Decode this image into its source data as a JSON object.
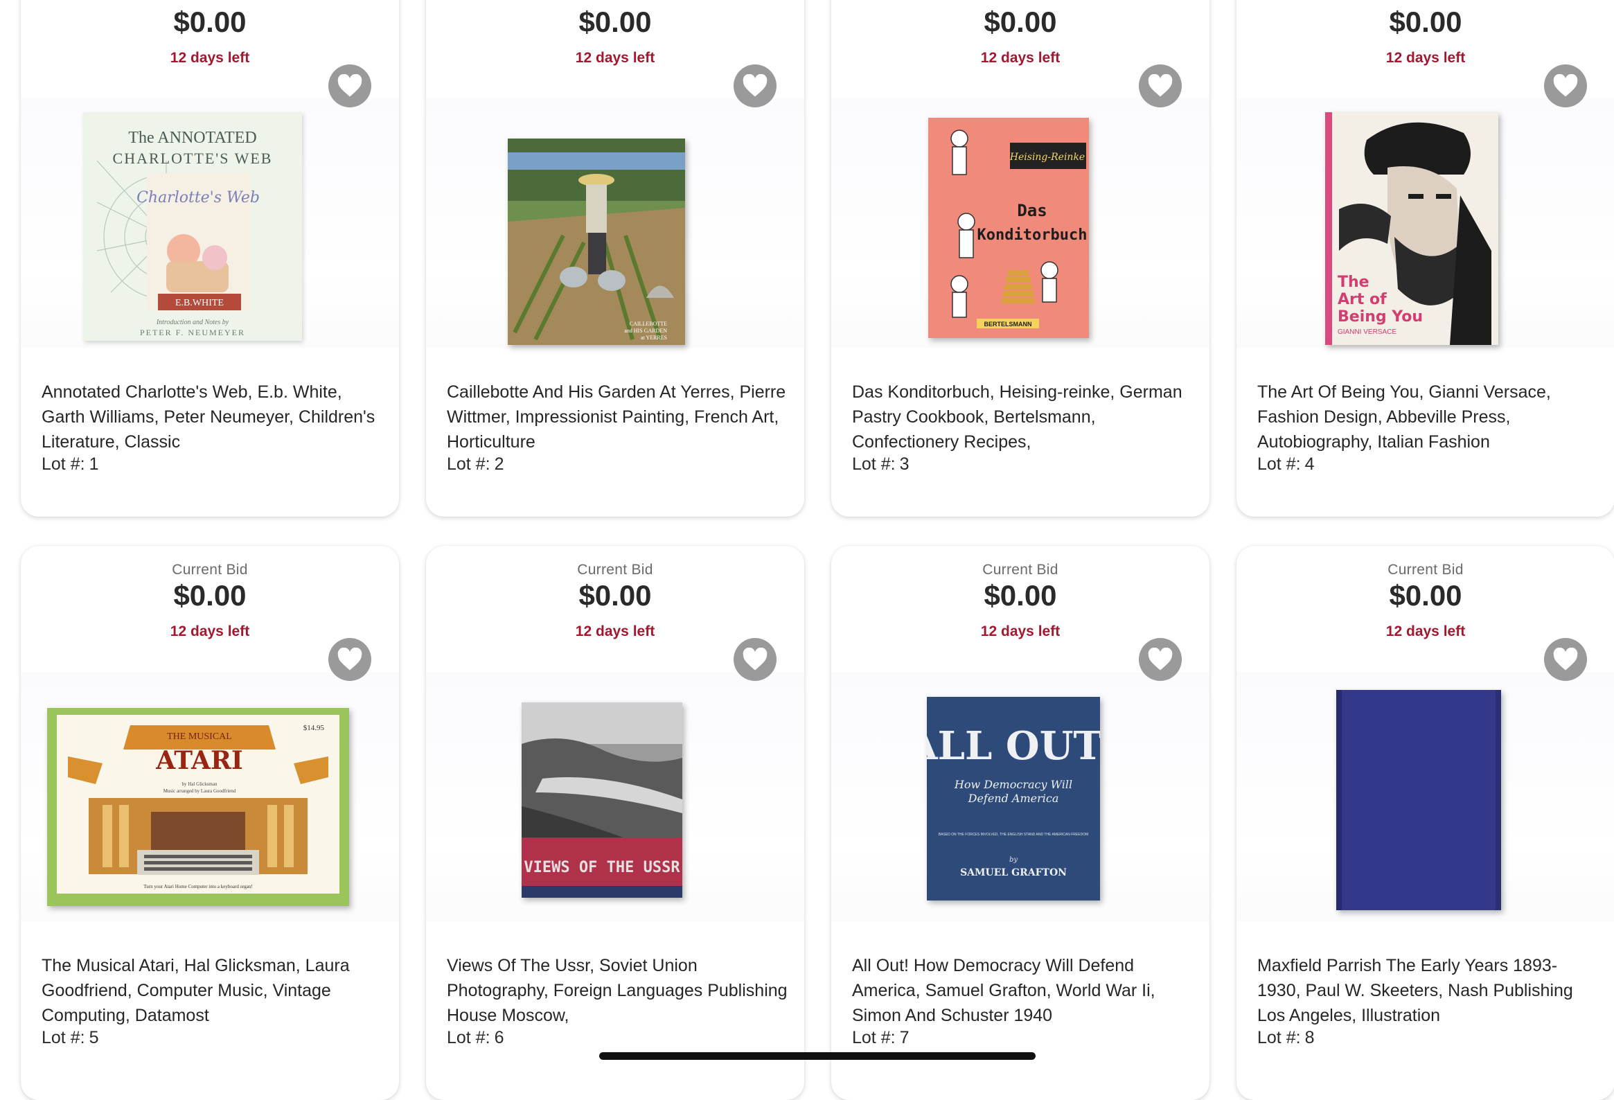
{
  "lots": [
    {
      "bid_label": "",
      "price": "$0.00",
      "time_left": "12 days left",
      "title": "Annotated Charlotte's Web, E.b. White, Garth Williams, Peter Neumeyer, Children's Literature, Classic",
      "lot_label": "Lot #:",
      "lot_number": "1"
    },
    {
      "bid_label": "",
      "price": "$0.00",
      "time_left": "12 days left",
      "title": "Caillebotte And His Garden At Yerres, Pierre Wittmer, Impressionist Painting, French Art, Horticulture",
      "lot_label": "Lot #:",
      "lot_number": "2"
    },
    {
      "bid_label": "",
      "price": "$0.00",
      "time_left": "12 days left",
      "title": "Das Konditorbuch, Heising-reinke, German Pastry Cookbook, Bertelsmann, Confectionery Recipes,",
      "lot_label": "Lot #:",
      "lot_number": "3"
    },
    {
      "bid_label": "",
      "price": "$0.00",
      "time_left": "12 days left",
      "title": "The Art Of Being You, Gianni Versace, Fashion Design, Abbeville Press, Autobiography, Italian Fashion",
      "lot_label": "Lot #:",
      "lot_number": "4"
    },
    {
      "bid_label": "Current Bid",
      "price": "$0.00",
      "time_left": "12 days left",
      "title": "The Musical Atari, Hal Glicksman, Laura Goodfriend, Computer Music, Vintage Computing, Datamost",
      "lot_label": "Lot #:",
      "lot_number": "5"
    },
    {
      "bid_label": "Current Bid",
      "price": "$0.00",
      "time_left": "12 days left",
      "title": "Views Of The Ussr, Soviet Union Photography, Foreign Languages Publishing House Moscow,",
      "lot_label": "Lot #:",
      "lot_number": "6"
    },
    {
      "bid_label": "Current Bid",
      "price": "$0.00",
      "time_left": "12 days left",
      "title": "All Out! How Democracy Will Defend America, Samuel Grafton, World War Ii, Simon And Schuster 1940",
      "lot_label": "Lot #:",
      "lot_number": "7"
    },
    {
      "bid_label": "Current Bid",
      "price": "$0.00",
      "time_left": "12 days left",
      "title": "Maxfield Parrish The Early Years 1893-1930, Paul W. Skeeters, Nash Publishing Los Angeles, Illustration",
      "lot_label": "Lot #:",
      "lot_number": "8"
    }
  ],
  "covers": {
    "charlotte": {
      "line1": "The ANNOTATED",
      "line2": "CHARLOTTE'S WEB",
      "script": "Charlotte's Web",
      "author": "E.B.WHITE",
      "credit1": "Introduction and Notes by",
      "credit2": "PETER F. NEUMEYER"
    },
    "caillebotte": {
      "line1": "CAILLEBOTTE",
      "line2": "and HIS GARDEN",
      "line3": "at YERRES"
    },
    "konditor": {
      "band": "Heising-Reinke",
      "title1": "Das",
      "title2": "Konditorbuch",
      "publisher": "BERTELSMANN"
    },
    "versace": {
      "title1": "The",
      "title2": "Art of",
      "title3": "Being You",
      "author": "GIANNI VERSACE"
    },
    "atari": {
      "top": "THE MUSICAL",
      "title": "ATARI",
      "price": "$14.95",
      "byline1": "by Hal Glicksman",
      "byline2": "Music arranged by Laura Goodfriend",
      "footer": "Turn your Atari Home Computer into a keyboard organ!"
    },
    "ussr": {
      "title": "VIEWS OF THE USSR"
    },
    "allout": {
      "title": "ALL OUT!",
      "subtitle1": "How Democracy Will",
      "subtitle2": "Defend America",
      "note": "BASED ON THE FORCES INVOLVED, THE ENGLISH STAND AND THE AMERICAN FREEDOM",
      "by": "by",
      "author": "SAMUEL GRAFTON"
    }
  },
  "colors": {
    "price_time": "#a3182f",
    "favorite_bg": "#9a9a9a"
  },
  "icons": {
    "favorite": "heart-icon"
  }
}
